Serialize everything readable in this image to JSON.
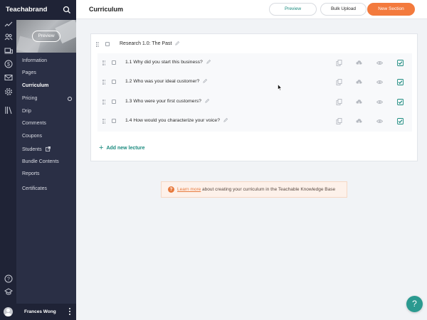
{
  "brand": {
    "name": "Teachabrand"
  },
  "header": {
    "title": "Curriculum",
    "buttons": {
      "preview": "Preview",
      "bulk_upload": "Bulk Upload",
      "new_section": "New Section"
    }
  },
  "sidebar": {
    "preview_label": "Preview",
    "items": [
      {
        "label": "Information"
      },
      {
        "label": "Pages"
      },
      {
        "label": "Curriculum",
        "active": true
      },
      {
        "label": "Pricing"
      },
      {
        "label": "Drip"
      },
      {
        "label": "Comments"
      },
      {
        "label": "Coupons"
      },
      {
        "label": "Students"
      },
      {
        "label": "Bundle Contents"
      },
      {
        "label": "Reports"
      },
      {
        "label": "Certificates"
      }
    ],
    "rail_icons": [
      "trending-up-icon",
      "users-icon",
      "devices-icon",
      "dollar-icon",
      "mail-icon",
      "gear-icon",
      "library-icon"
    ],
    "bottom_icons": [
      "help-circle-icon",
      "graduation-cap-icon"
    ]
  },
  "user": {
    "name": "Frances Wong"
  },
  "section": {
    "title": "Research 1.0: The Past",
    "lectures": [
      {
        "title": "1.1 Why did you start this business?",
        "published": true
      },
      {
        "title": "1.2 Who was your ideal customer?",
        "published": true
      },
      {
        "title": "1.3 Who were your first customers?",
        "published": true
      },
      {
        "title": "1.4 How would you characterize your voice?",
        "published": true
      }
    ],
    "add_lecture_label": "Add new lecture"
  },
  "info_banner": {
    "link_text": "Learn more",
    "text": " about creating your curriculum in the Teachable Knowledge Base"
  },
  "help": {
    "label": "?"
  },
  "colors": {
    "accent": "#1a8a7e",
    "brand_orange": "#f37a3d",
    "sidebar_bg": "#2a2f45"
  }
}
